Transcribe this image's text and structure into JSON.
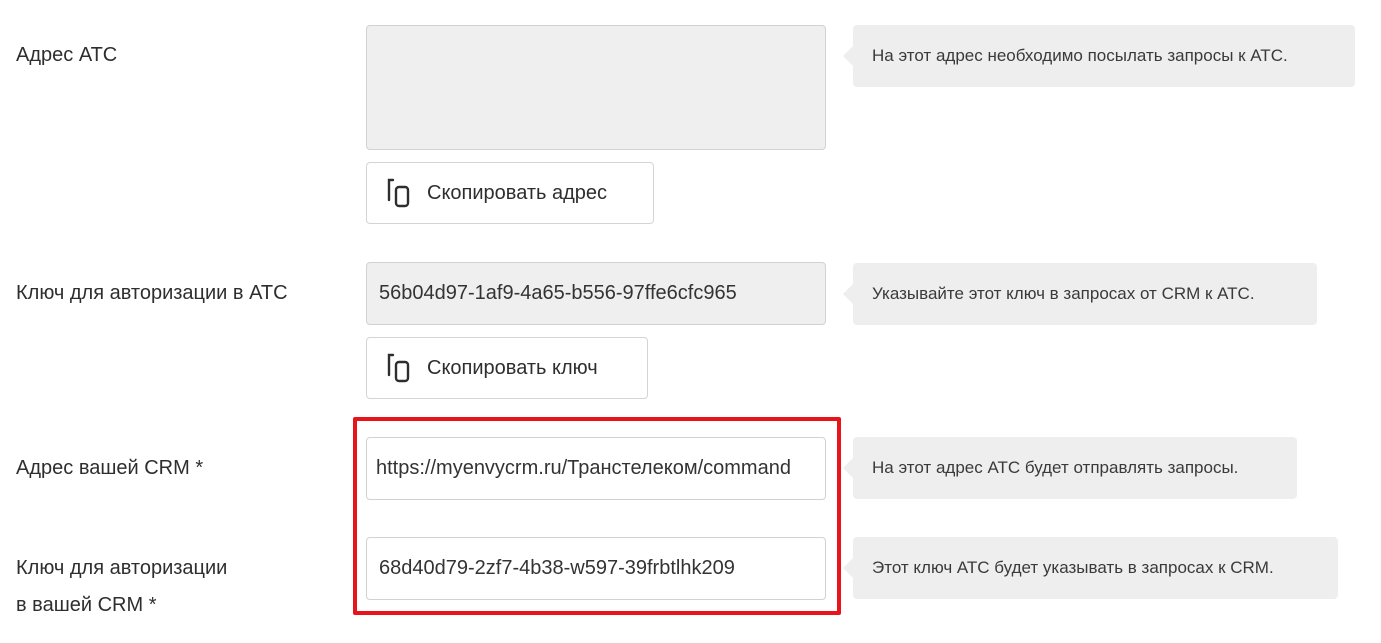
{
  "pbx_address": {
    "label": "Адрес АТС",
    "value": "",
    "hint": "На этот адрес необходимо посылать запросы к АТС.",
    "copy_button": "Скопировать адрес"
  },
  "pbx_key": {
    "label": "Ключ для авторизации в АТС",
    "value": "56b04d97-1af9-4a65-b556-97ffe6cfc965",
    "hint": "Указывайте этот ключ в запросах от CRM к АТС.",
    "copy_button": "Скопировать ключ"
  },
  "crm_address": {
    "label": "Адрес вашей CRM *",
    "value": "https://myenvycrm.ru/Транстелеком/command",
    "hint": "На этот адрес АТС будет отправлять запросы."
  },
  "crm_key": {
    "label_line1": "Ключ для авторизации",
    "label_line2": "в вашей CRM *",
    "value": "68d40d79-2zf7-4b38-w597-39frbtlhk209",
    "hint": "Этот ключ АТС будет указывать в запросах к CRM."
  },
  "colors": {
    "highlight": "#e8131b",
    "readonly_bg": "#efefef",
    "hint_bg": "#eeeeee"
  },
  "icons": {
    "copy": "copy-icon"
  }
}
